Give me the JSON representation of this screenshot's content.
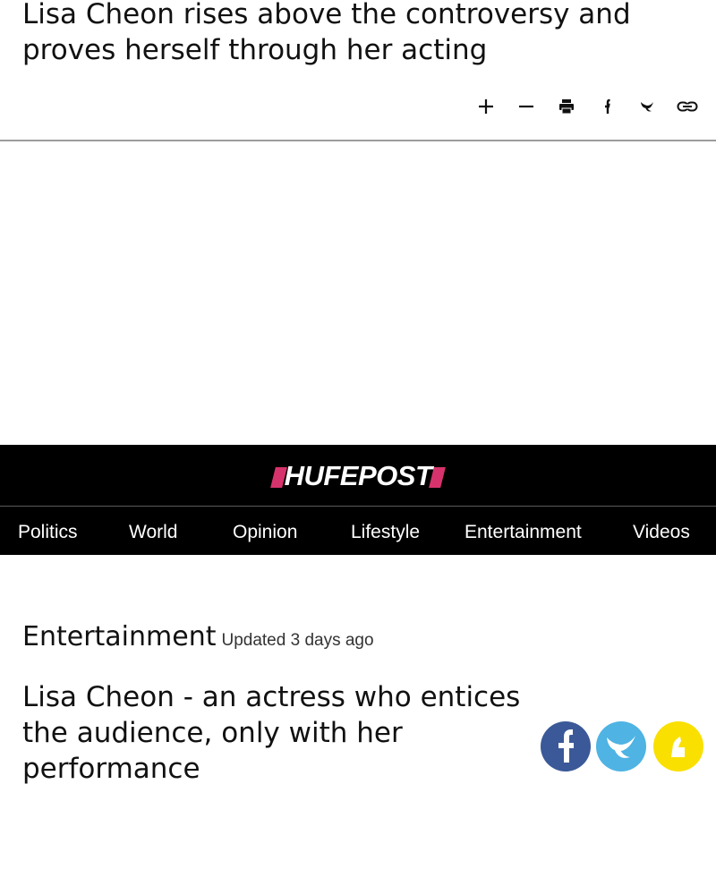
{
  "top": {
    "title": "Lisa Cheon rises above the controversy and proves herself through her acting",
    "toolbar": [
      {
        "name": "increase-font-button",
        "icon": "plus-icon"
      },
      {
        "name": "decrease-font-button",
        "icon": "minus-icon"
      },
      {
        "name": "print-button",
        "icon": "print-icon"
      },
      {
        "name": "facebook-share-button",
        "icon": "facebook-icon"
      },
      {
        "name": "twitter-share-button",
        "icon": "twitter-icon"
      },
      {
        "name": "copy-link-button",
        "icon": "link-icon"
      }
    ]
  },
  "masthead": {
    "logo": "HUFEPOST",
    "background": "#000000",
    "accent": "#d6336c"
  },
  "nav": {
    "items": [
      "Politics",
      "World",
      "Opinion",
      "Lifestyle",
      "Entertainment",
      "Videos"
    ]
  },
  "article": {
    "section": "Entertainment",
    "updated": "Updated 3 days ago",
    "headline": "Lisa Cheon - an actress who entices the audience, only with her performance",
    "share": [
      {
        "name": "facebook",
        "icon": "facebook-icon",
        "color": "#3b5998"
      },
      {
        "name": "twitter",
        "icon": "twitter-icon",
        "color": "#4fb3e3"
      },
      {
        "name": "kakaotalk",
        "icon": "kakaotalk-icon",
        "color": "#f9e000"
      }
    ]
  }
}
